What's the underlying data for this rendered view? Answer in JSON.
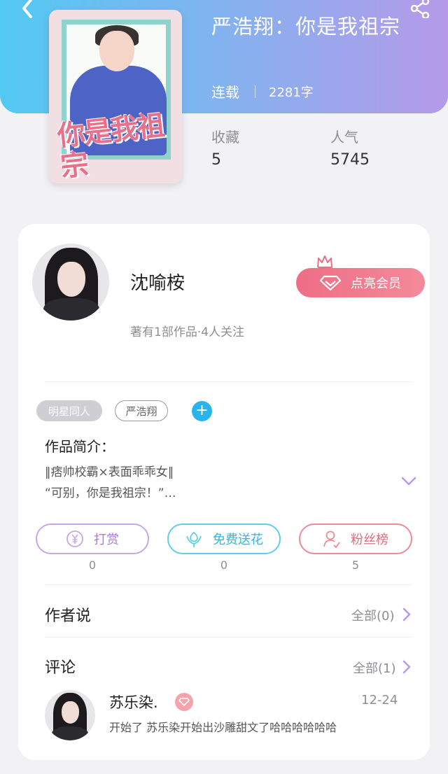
{
  "book": {
    "title": "严浩翔：你是我祖宗",
    "status": "连载",
    "word_count": "2281字",
    "cover_text": "你是我祖宗"
  },
  "stats": [
    {
      "label": "收藏",
      "value": "5"
    },
    {
      "label": "人气",
      "value": "5745"
    }
  ],
  "author": {
    "name": "沈喻桉",
    "meta": "著有1部作品·4人关注",
    "vip_label": "点亮会员"
  },
  "tags": [
    "明星同人",
    "严浩翔"
  ],
  "intro": {
    "heading": "作品简介：",
    "lines": [
      "‖痞帅校霸×表面乖乖女‖",
      "“可别，你是我祖宗！”…"
    ]
  },
  "actions": [
    {
      "label": "打赏",
      "count": "0",
      "icon": "yen-circle-icon"
    },
    {
      "label": "免费送花",
      "count": "0",
      "icon": "flower-icon"
    },
    {
      "label": "粉丝榜",
      "count": "5",
      "icon": "user-icon"
    }
  ],
  "author_says": {
    "title": "作者说",
    "link": "全部(0)"
  },
  "comments": {
    "title": "评论",
    "link": "全部(1)",
    "items": [
      {
        "user": "苏乐染.",
        "date": "12-24",
        "text": "开始了 苏乐染开始出沙雕甜文了哈哈哈哈哈哈"
      }
    ]
  },
  "colors": {
    "header_start": "#52c9f2",
    "header_end": "#b59ae9",
    "vip": "#ee6d86",
    "reward": "#a57ed4",
    "flower": "#2eb8dc",
    "fans": "#e26b7c",
    "add_tag": "#2ab4ef"
  }
}
